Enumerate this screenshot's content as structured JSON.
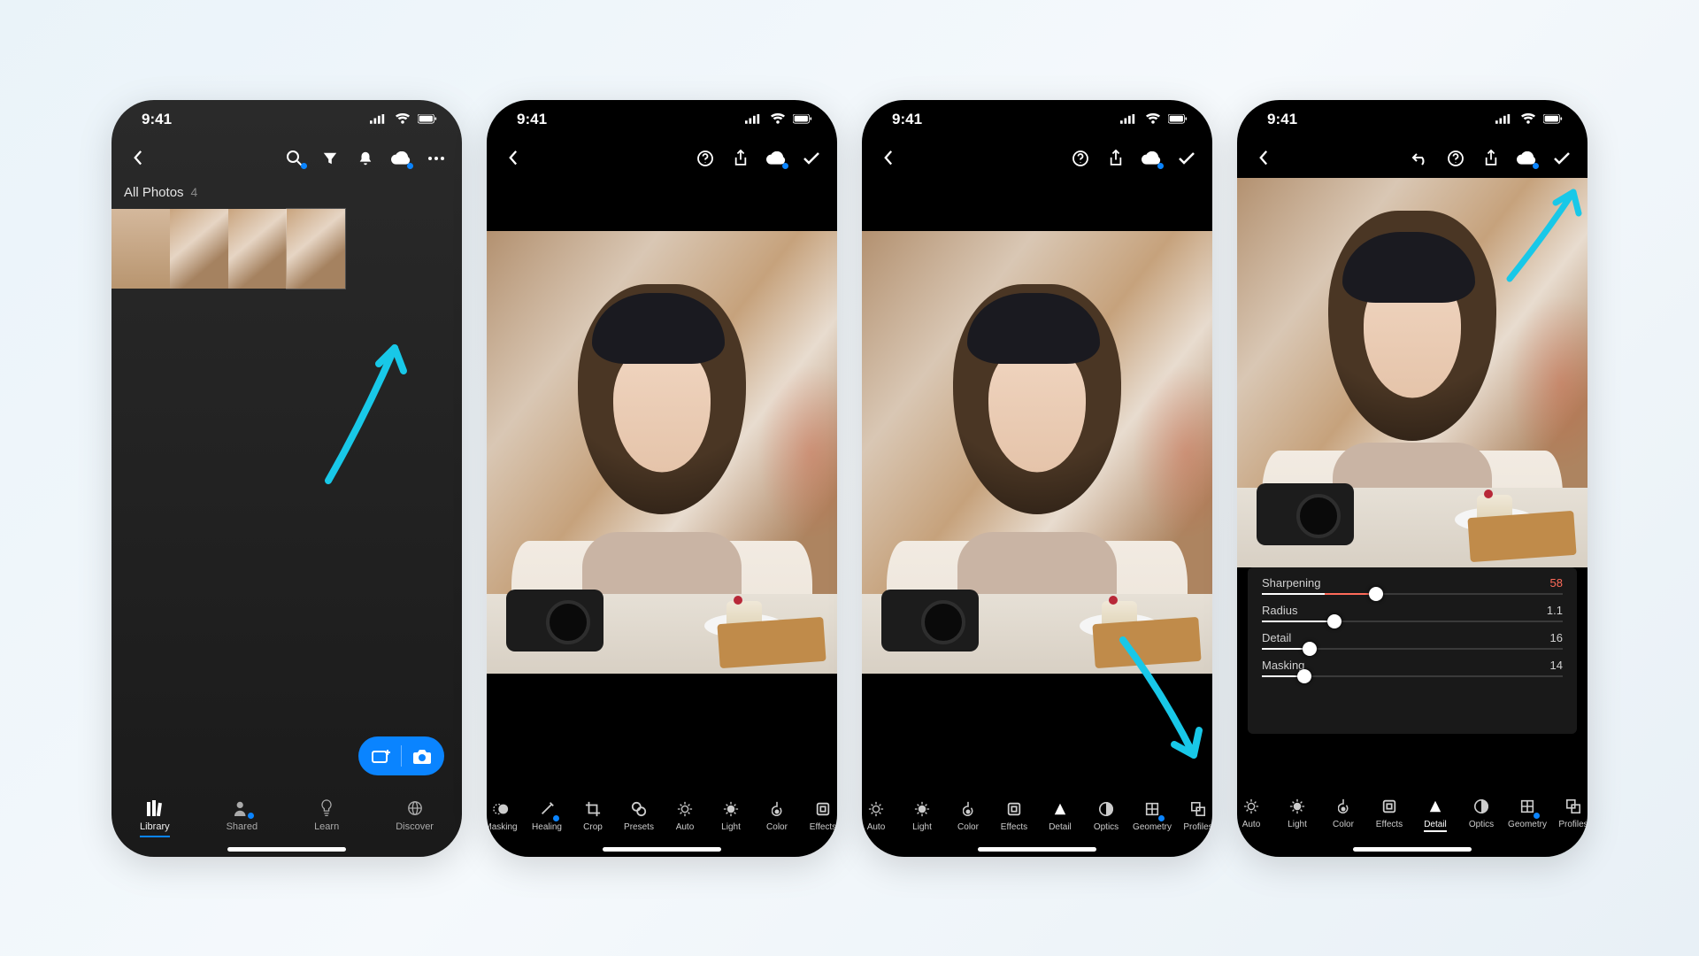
{
  "status": {
    "time": "9:41"
  },
  "screen1": {
    "album": {
      "title": "All Photos",
      "count": "4"
    },
    "tabs": [
      {
        "label": "Library",
        "icon": "books-icon"
      },
      {
        "label": "Shared",
        "icon": "person-share-icon"
      },
      {
        "label": "Learn",
        "icon": "lightbulb-icon"
      },
      {
        "label": "Discover",
        "icon": "globe-icon"
      }
    ],
    "nav_icons": [
      "search-icon",
      "filter-icon",
      "bell-icon",
      "cloud-sync-icon",
      "more-icon"
    ]
  },
  "screen2": {
    "nav_icons_right": [
      "help-icon",
      "share-icon",
      "cloud-sync-icon",
      "checkmark-icon"
    ],
    "tools": [
      {
        "label": "Masking",
        "icon": "masking-icon"
      },
      {
        "label": "Healing",
        "icon": "healing-icon"
      },
      {
        "label": "Crop",
        "icon": "crop-icon"
      },
      {
        "label": "Presets",
        "icon": "presets-icon"
      },
      {
        "label": "Auto",
        "icon": "auto-icon"
      },
      {
        "label": "Light",
        "icon": "light-icon"
      },
      {
        "label": "Color",
        "icon": "color-icon"
      },
      {
        "label": "Effects",
        "icon": "effects-icon"
      }
    ]
  },
  "screen3": {
    "nav_icons_right": [
      "help-icon",
      "share-icon",
      "cloud-sync-icon",
      "checkmark-icon"
    ],
    "tools": [
      {
        "label": "Auto",
        "icon": "auto-icon"
      },
      {
        "label": "Light",
        "icon": "light-icon"
      },
      {
        "label": "Color",
        "icon": "color-icon"
      },
      {
        "label": "Effects",
        "icon": "effects-icon"
      },
      {
        "label": "Detail",
        "icon": "detail-icon"
      },
      {
        "label": "Optics",
        "icon": "optics-icon"
      },
      {
        "label": "Geometry",
        "icon": "geometry-icon"
      },
      {
        "label": "Profiles",
        "icon": "profiles-icon"
      }
    ]
  },
  "screen4": {
    "nav_icons_right": [
      "undo-icon",
      "help-icon",
      "share-icon",
      "cloud-sync-icon",
      "checkmark-icon"
    ],
    "sliders": [
      {
        "label": "Sharpening",
        "value": "58",
        "pct": 38,
        "red": true
      },
      {
        "label": "Radius",
        "value": "1.1",
        "pct": 24,
        "red": false
      },
      {
        "label": "Detail",
        "value": "16",
        "pct": 16,
        "red": false
      },
      {
        "label": "Masking",
        "value": "14",
        "pct": 14,
        "red": false
      }
    ],
    "tools": [
      {
        "label": "Auto",
        "icon": "auto-icon"
      },
      {
        "label": "Light",
        "icon": "light-icon"
      },
      {
        "label": "Color",
        "icon": "color-icon"
      },
      {
        "label": "Effects",
        "icon": "effects-icon"
      },
      {
        "label": "Detail",
        "icon": "detail-icon",
        "active": true
      },
      {
        "label": "Optics",
        "icon": "optics-icon"
      },
      {
        "label": "Geometry",
        "icon": "geometry-icon"
      },
      {
        "label": "Profiles",
        "icon": "profiles-icon"
      }
    ]
  }
}
